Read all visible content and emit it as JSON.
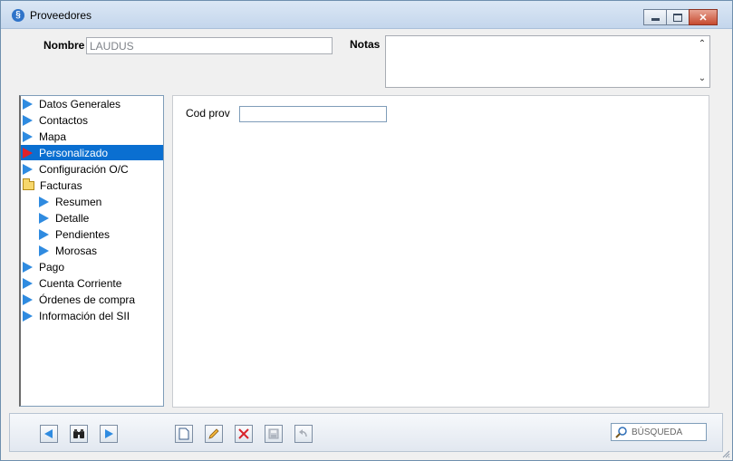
{
  "window": {
    "title": "Proveedores",
    "close_glyph": "✕"
  },
  "header": {
    "nombre_label": "Nombre",
    "nombre_value": "LAUDUS",
    "notas_label": "Notas",
    "notas_value": "",
    "scroll_up": "⌃",
    "scroll_down": "⌄"
  },
  "tree": {
    "items": [
      {
        "label": "Datos Generales",
        "icon": "blue-triangle-icon"
      },
      {
        "label": "Contactos",
        "icon": "blue-triangle-icon"
      },
      {
        "label": "Mapa",
        "icon": "blue-triangle-icon"
      },
      {
        "label": "Personalizado",
        "icon": "red-triangle-icon",
        "selected": true
      },
      {
        "label": "Configuración O/C",
        "icon": "blue-triangle-icon"
      },
      {
        "label": "Facturas",
        "icon": "folder-icon"
      },
      {
        "label": "Resumen",
        "icon": "blue-triangle-icon",
        "indent": 1
      },
      {
        "label": "Detalle",
        "icon": "blue-triangle-icon",
        "indent": 1
      },
      {
        "label": "Pendientes",
        "icon": "blue-triangle-icon",
        "indent": 1
      },
      {
        "label": "Morosas",
        "icon": "blue-triangle-icon",
        "indent": 1
      },
      {
        "label": "Pago",
        "icon": "blue-triangle-icon"
      },
      {
        "label": "Cuenta Corriente",
        "icon": "blue-triangle-icon"
      },
      {
        "label": "Órdenes de compra",
        "icon": "blue-triangle-icon"
      },
      {
        "label": "Información del SII",
        "icon": "blue-triangle-icon"
      }
    ]
  },
  "content": {
    "cod_prov_label": "Cod prov",
    "cod_prov_value": ""
  },
  "toolbar": {
    "search_label": "BÚSQUEDA",
    "buttons": [
      "previous-icon",
      "binoculars-icon",
      "next-icon",
      "new-document-icon",
      "edit-pencil-icon",
      "delete-x-icon",
      "save-disk-icon",
      "undo-icon"
    ]
  },
  "colors": {
    "selection": "#0a6fd1",
    "arrow_blue": "#2f8be0",
    "arrow_red": "#e0222b"
  }
}
